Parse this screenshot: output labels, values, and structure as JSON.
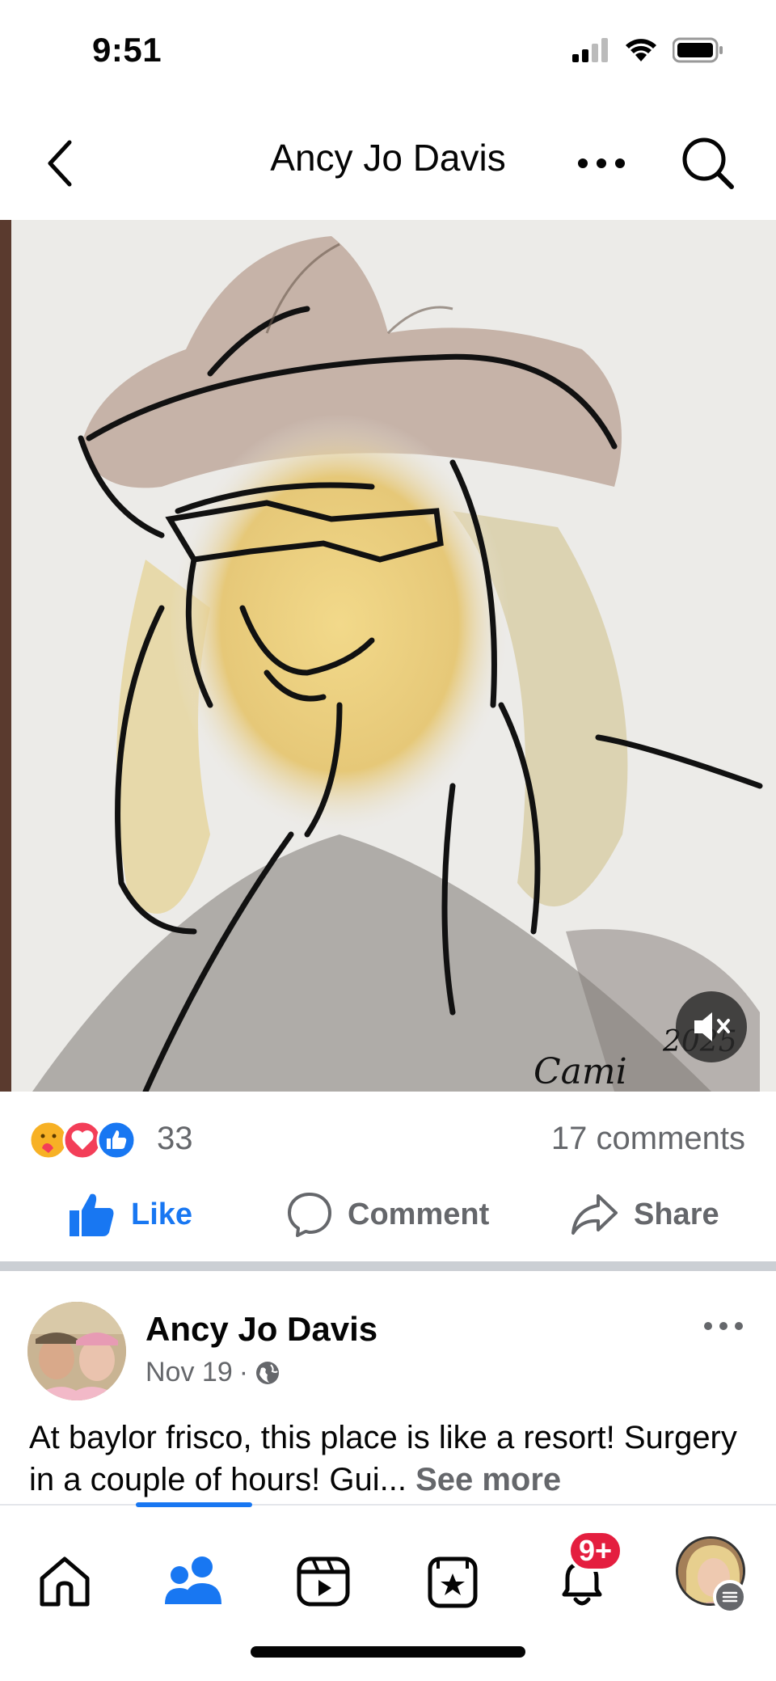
{
  "status_bar": {
    "time": "9:51",
    "icons": [
      "cellular-signal-icon",
      "wifi-icon",
      "battery-icon"
    ]
  },
  "header": {
    "title": "Ancy Jo Davis",
    "icons": [
      "chevron-left-icon",
      "more-horizontal-icon",
      "search-icon"
    ]
  },
  "post": {
    "media_description_icon": "caricature-artwork",
    "artwork_signature": "Cami 2025",
    "mute_icon": "speaker-muted-icon",
    "reactions": {
      "types": [
        "care",
        "love",
        "like"
      ],
      "count": "33"
    },
    "comments_count": "17 comments",
    "actions": {
      "like": "Like",
      "comment": "Comment",
      "share": "Share"
    }
  },
  "next_post": {
    "author": "Ancy Jo Davis",
    "date": "Nov 19",
    "separator": "·",
    "privacy_icon": "globe-icon",
    "text": "At baylor frisco, this place is like a resort! Surgery in a couple of hours! Gui...",
    "see_more": "See more"
  },
  "bottom_nav": {
    "items": [
      "home",
      "friends",
      "video",
      "feeds",
      "notifications",
      "profile"
    ],
    "active": "friends",
    "notification_badge": "9+"
  },
  "colors": {
    "accent": "#1877f2",
    "secondary_text": "#65676b",
    "badge": "#e41e3f",
    "love": "#f33e58",
    "care": "#f7b125"
  }
}
